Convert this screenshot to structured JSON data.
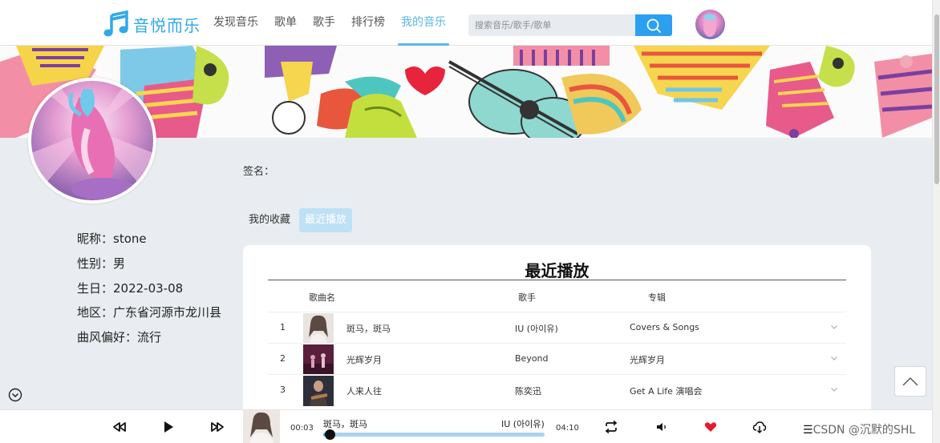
{
  "header": {
    "logo_text": "音悦而乐",
    "nav": [
      "发现音乐",
      "歌单",
      "歌手",
      "排行榜",
      "我的音乐"
    ],
    "active_nav": 4,
    "search_placeholder": "搜索音乐/歌手/歌单",
    "accent_color": "#2c9ff0"
  },
  "profile": {
    "nickname": "昵称：stone",
    "gender": "性别：男",
    "birthday": "生日：2022-03-08",
    "region": "地区：广东省河源市龙川县",
    "genre": "曲风偏好：流行",
    "signature_label": "签名："
  },
  "tabs": [
    "我的收藏",
    "最近播放"
  ],
  "active_tab": 1,
  "recent": {
    "title": "最近播放",
    "columns": [
      "歌曲名",
      "歌手",
      "专辑"
    ],
    "rows": [
      {
        "index": "1",
        "song": "斑马，斑马",
        "artist": "IU (아이유)",
        "album": "Covers & Songs"
      },
      {
        "index": "2",
        "song": "光辉岁月",
        "artist": "Beyond",
        "album": "光辉岁月"
      },
      {
        "index": "3",
        "song": "人来人往",
        "artist": "陈奕迅",
        "album": "Get A Life 演唱会"
      }
    ]
  },
  "player": {
    "current_time": "00:03",
    "total_time": "04:10",
    "song": "斑马，斑马",
    "artist": "IU (아이유)",
    "progress": 0.03,
    "liked_color": "#e8192c"
  },
  "watermark": "CSDN @沉默的SHL"
}
